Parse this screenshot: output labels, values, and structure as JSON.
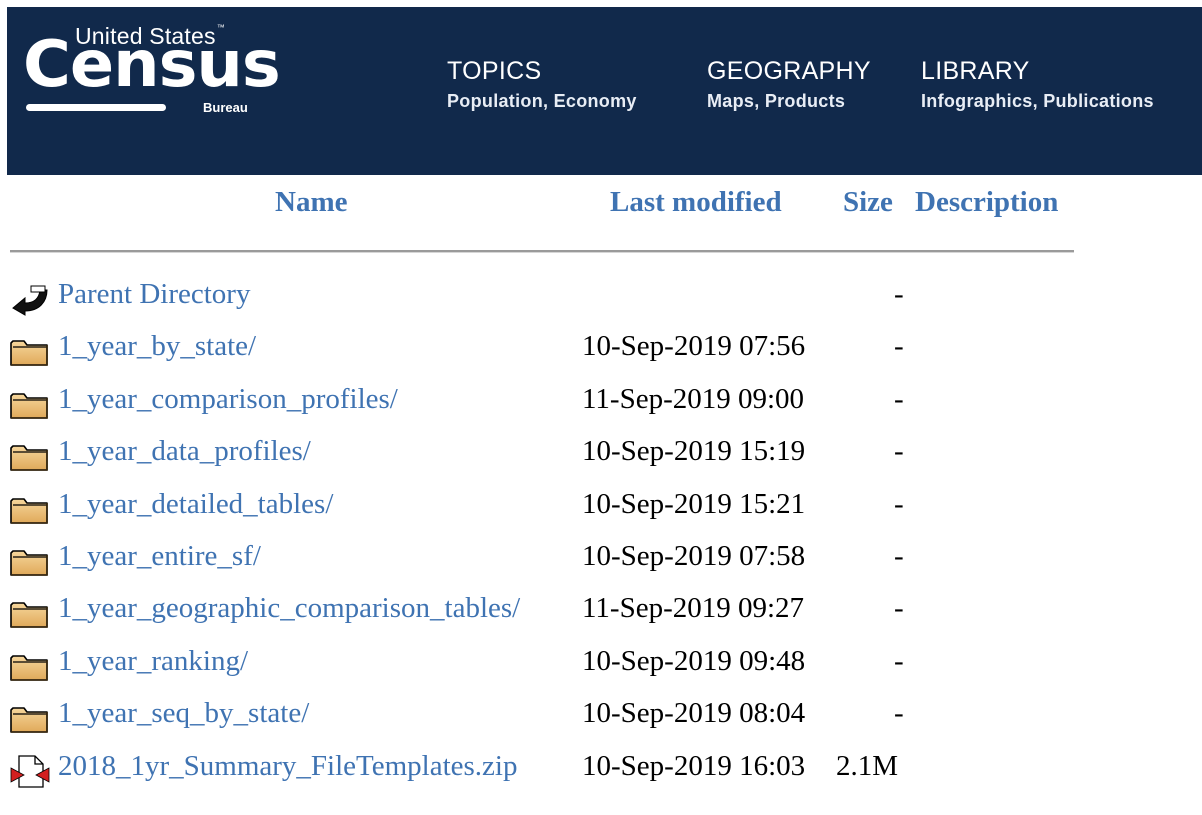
{
  "header": {
    "logo_top": "United States",
    "logo_tm": "™",
    "logo_main": "Census",
    "logo_bottom": "Bureau",
    "nav": [
      {
        "title": "TOPICS",
        "sub": "Population, Economy"
      },
      {
        "title": "GEOGRAPHY",
        "sub": "Maps, Products"
      },
      {
        "title": "LIBRARY",
        "sub": "Infographics, Publications"
      }
    ],
    "background_color": "#11294b"
  },
  "listing": {
    "columns": {
      "name": "Name",
      "last_modified": "Last modified",
      "size": "Size",
      "description": "Description"
    },
    "link_color": "#3f73b2",
    "rows": [
      {
        "icon": "parent-directory-icon",
        "name": "Parent Directory",
        "modified": "",
        "size": "-"
      },
      {
        "icon": "folder-icon",
        "name": "1_year_by_state/",
        "modified": "10-Sep-2019 07:56",
        "size": "-"
      },
      {
        "icon": "folder-icon",
        "name": "1_year_comparison_profiles/",
        "modified": "11-Sep-2019 09:00",
        "size": "-"
      },
      {
        "icon": "folder-icon",
        "name": "1_year_data_profiles/",
        "modified": "10-Sep-2019 15:19",
        "size": "-"
      },
      {
        "icon": "folder-icon",
        "name": "1_year_detailed_tables/",
        "modified": "10-Sep-2019 15:21",
        "size": "-"
      },
      {
        "icon": "folder-icon",
        "name": "1_year_entire_sf/",
        "modified": "10-Sep-2019 07:58",
        "size": "-"
      },
      {
        "icon": "folder-icon",
        "name": "1_year_geographic_comparison_tables/",
        "modified": "11-Sep-2019 09:27",
        "size": "-"
      },
      {
        "icon": "folder-icon",
        "name": "1_year_ranking/",
        "modified": "10-Sep-2019 09:48",
        "size": "-"
      },
      {
        "icon": "folder-icon",
        "name": "1_year_seq_by_state/",
        "modified": "10-Sep-2019 08:04",
        "size": "-"
      },
      {
        "icon": "compressed-file-icon",
        "name": "2018_1yr_Summary_FileTemplates.zip",
        "modified": "10-Sep-2019 16:03",
        "size": "2.1M"
      }
    ]
  }
}
